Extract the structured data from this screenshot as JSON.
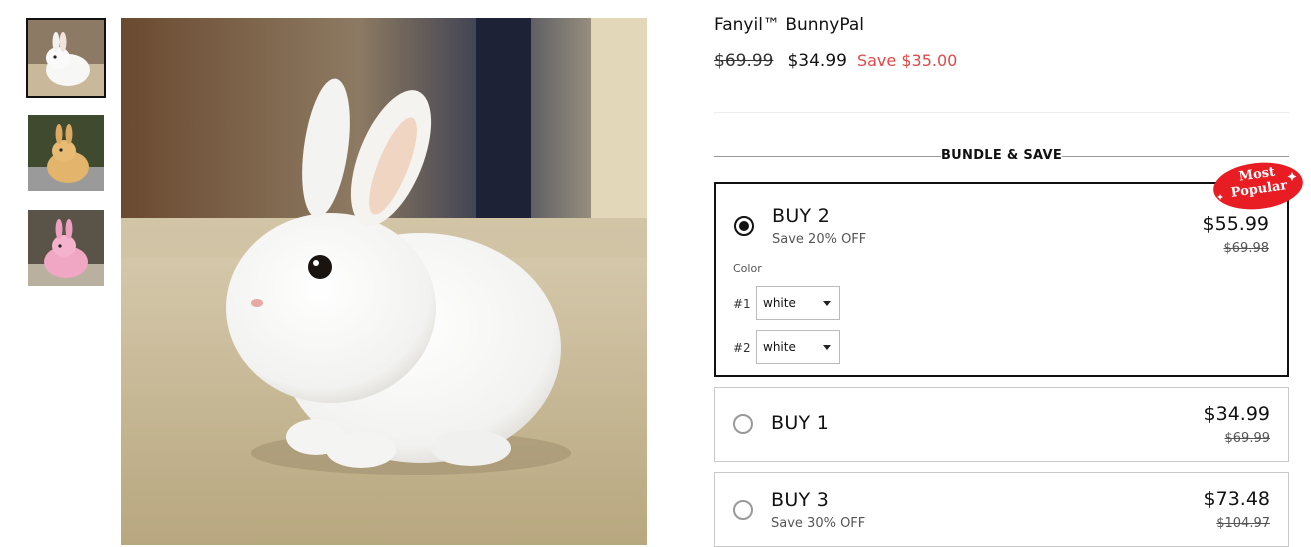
{
  "product": {
    "title": "Fanyil™ BunnyPal",
    "compare_price": "$69.99",
    "price": "$34.99",
    "save_text": "Save $35.00"
  },
  "gallery": {
    "thumbnails": [
      {
        "alt": "white bunny",
        "color": "#f4f4f2"
      },
      {
        "alt": "golden bunny",
        "color": "#e3b46c"
      },
      {
        "alt": "pink bunny",
        "color": "#f0a7c4"
      }
    ]
  },
  "bundle": {
    "heading": "BUNDLE & SAVE",
    "badge_line1": "Most",
    "badge_line2": "Popular",
    "badge_color": "#e81c23",
    "options": [
      {
        "title": "BUY 2",
        "subtitle": "Save 20% OFF",
        "price": "$55.99",
        "compare": "$69.98",
        "selected": true
      },
      {
        "title": "BUY 1",
        "subtitle": "",
        "price": "$34.99",
        "compare": "$69.99",
        "selected": false
      },
      {
        "title": "BUY 3",
        "subtitle": "Save 30% OFF",
        "price": "$73.48",
        "compare": "$104.97",
        "selected": false
      }
    ],
    "color_label": "Color",
    "variants": [
      {
        "label": "#1",
        "value": "white"
      },
      {
        "label": "#2",
        "value": "white"
      }
    ]
  }
}
